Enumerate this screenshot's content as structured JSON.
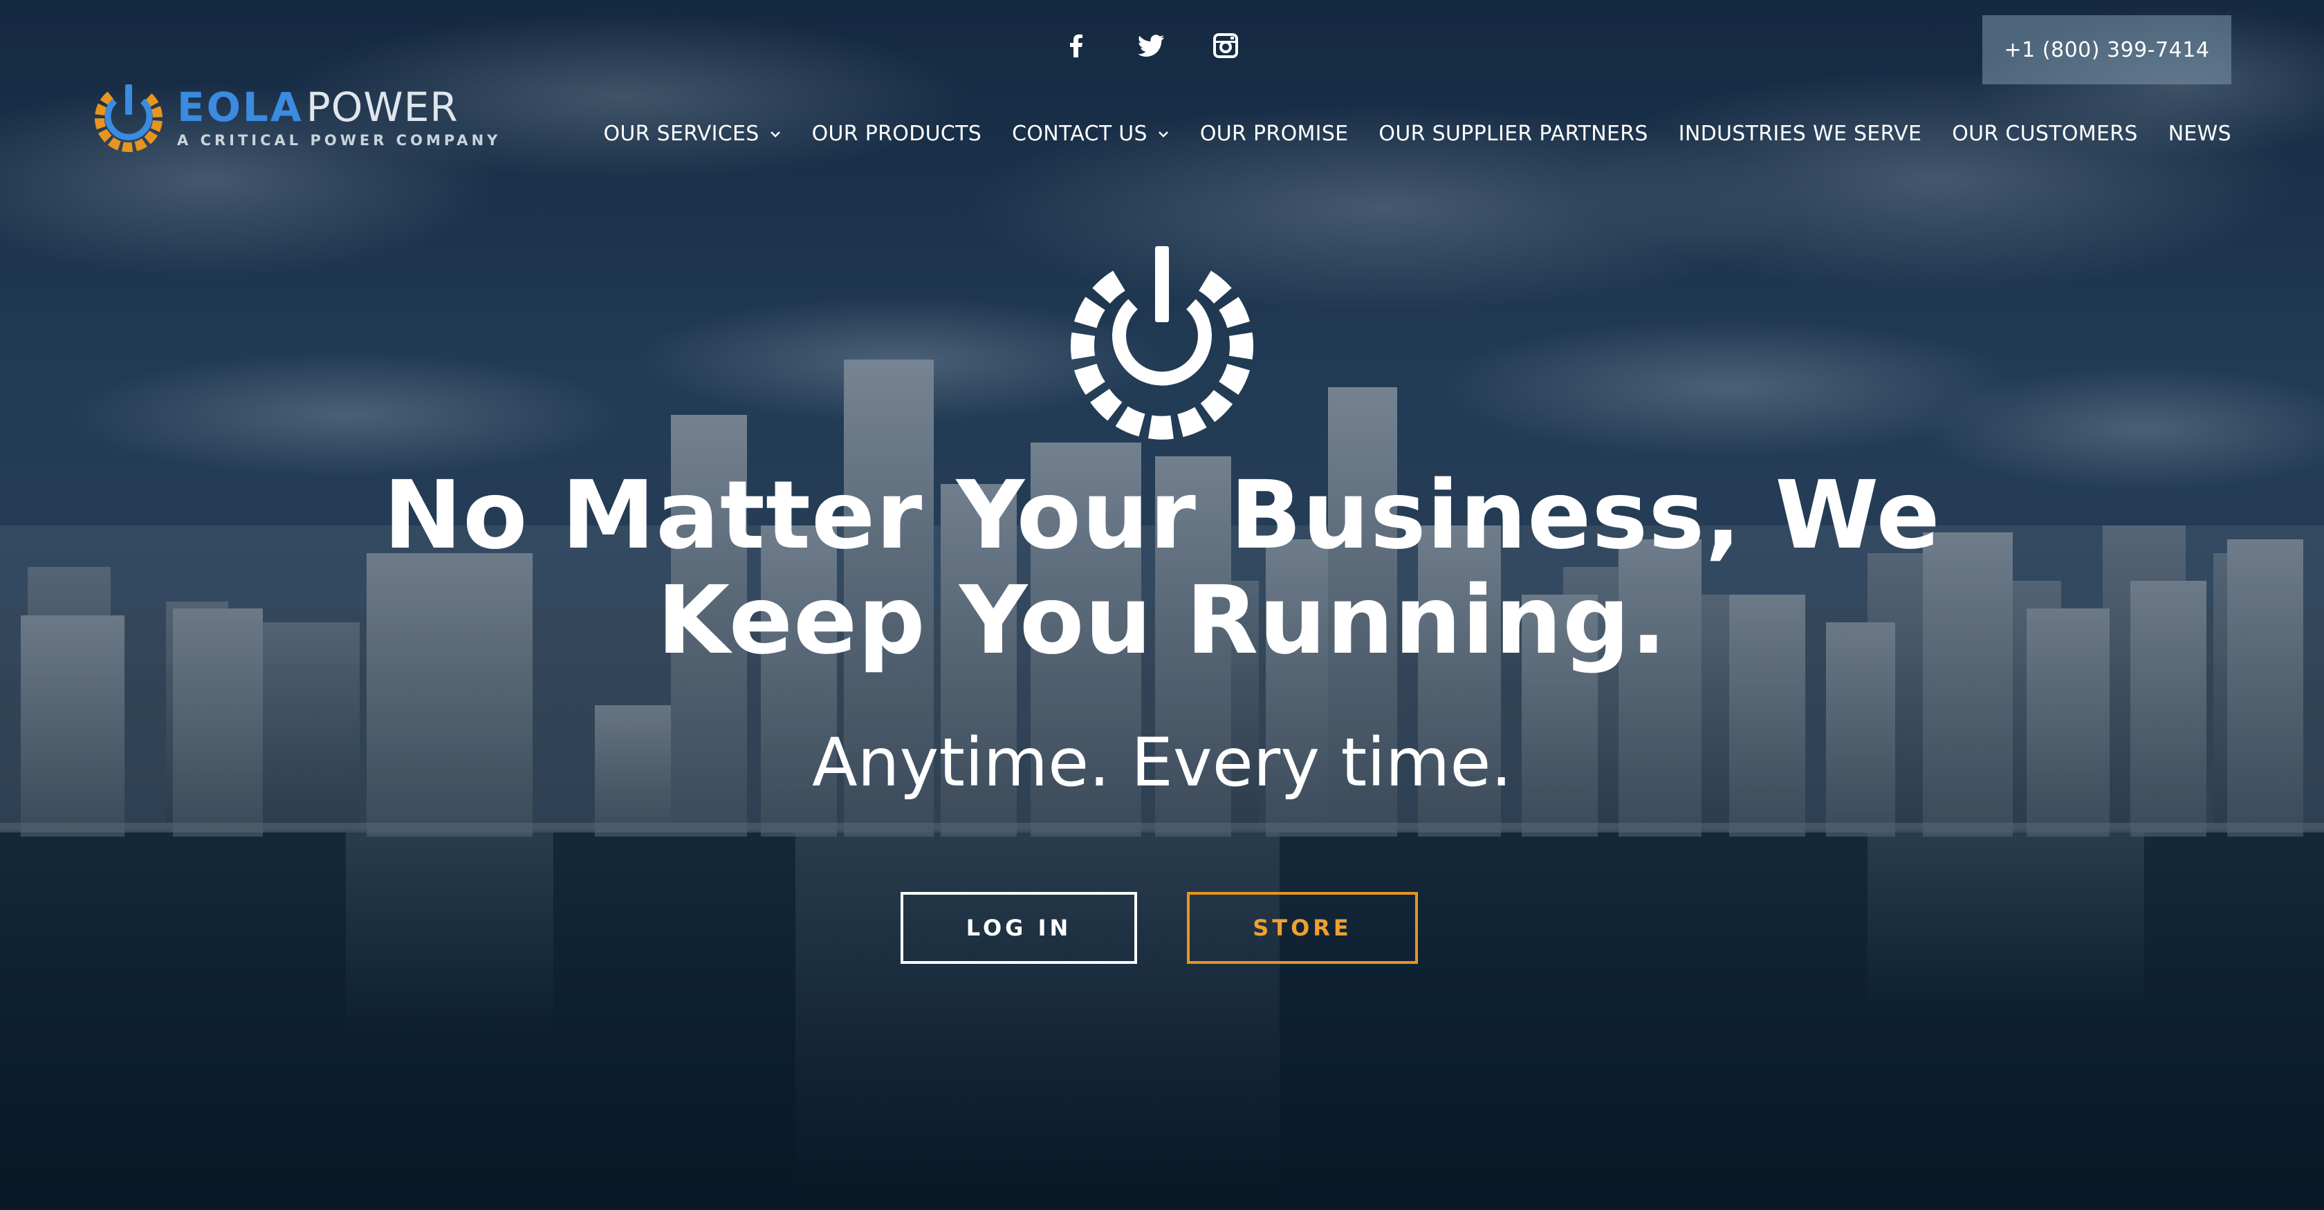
{
  "social": {
    "icons": [
      "facebook-icon",
      "twitter-icon",
      "instagram-icon"
    ]
  },
  "header": {
    "phone": "+1 (800) 399-7414"
  },
  "logo": {
    "brand_part1": "EOLA",
    "brand_part2": "POWER",
    "tagline": "A CRITICAL POWER COMPANY"
  },
  "nav": {
    "items": [
      {
        "label": "OUR SERVICES",
        "dropdown": true
      },
      {
        "label": "OUR PRODUCTS",
        "dropdown": false
      },
      {
        "label": "CONTACT US",
        "dropdown": true
      },
      {
        "label": "OUR PROMISE",
        "dropdown": false
      },
      {
        "label": "OUR SUPPLIER PARTNERS",
        "dropdown": false
      },
      {
        "label": "INDUSTRIES WE SERVE",
        "dropdown": false
      },
      {
        "label": "OUR CUSTOMERS",
        "dropdown": false
      },
      {
        "label": "NEWS",
        "dropdown": false
      }
    ]
  },
  "hero": {
    "title_line1": "No Matter Your Business, We",
    "title_line2": "Keep You Running.",
    "subtitle": "Anytime. Every time.",
    "login_label": "LOG IN",
    "store_label": "STORE"
  },
  "colors": {
    "brand_blue": "#3b8be0",
    "brand_orange": "#e8951f",
    "phone_button_bg": "#7c96aa"
  }
}
